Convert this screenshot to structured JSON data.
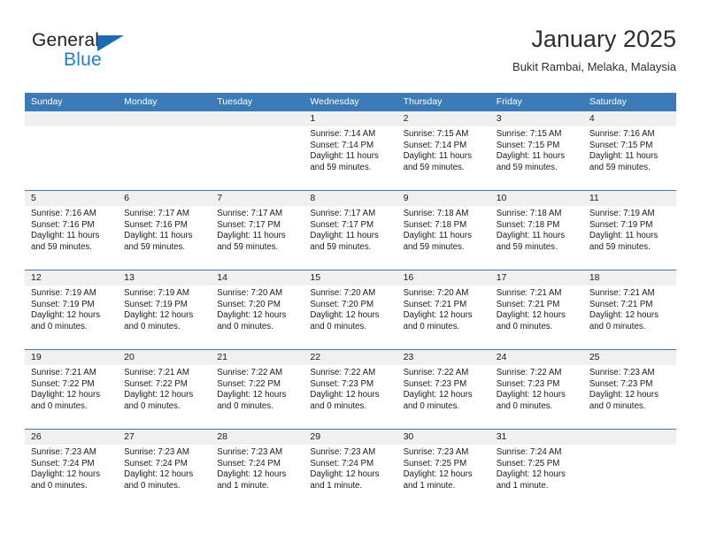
{
  "brand": {
    "name_top": "General",
    "name_bottom": "Blue",
    "accent_color": "#1d80c8",
    "triangle_color": "#1b6cb3"
  },
  "header": {
    "title": "January 2025",
    "subtitle": "Bukit Rambai, Melaka, Malaysia"
  },
  "theme": {
    "header_row_bg": "#3b7cb8",
    "daynum_band_bg": "#f0f0f0",
    "text_color": "#1a1a1a"
  },
  "weekdays": [
    "Sunday",
    "Monday",
    "Tuesday",
    "Wednesday",
    "Thursday",
    "Friday",
    "Saturday"
  ],
  "weeks": [
    {
      "days": [
        {
          "num": "",
          "lines": []
        },
        {
          "num": "",
          "lines": []
        },
        {
          "num": "",
          "lines": []
        },
        {
          "num": "1",
          "lines": [
            "Sunrise: 7:14 AM",
            "Sunset: 7:14 PM",
            "Daylight: 11 hours",
            "and 59 minutes."
          ]
        },
        {
          "num": "2",
          "lines": [
            "Sunrise: 7:15 AM",
            "Sunset: 7:14 PM",
            "Daylight: 11 hours",
            "and 59 minutes."
          ]
        },
        {
          "num": "3",
          "lines": [
            "Sunrise: 7:15 AM",
            "Sunset: 7:15 PM",
            "Daylight: 11 hours",
            "and 59 minutes."
          ]
        },
        {
          "num": "4",
          "lines": [
            "Sunrise: 7:16 AM",
            "Sunset: 7:15 PM",
            "Daylight: 11 hours",
            "and 59 minutes."
          ]
        }
      ]
    },
    {
      "days": [
        {
          "num": "5",
          "lines": [
            "Sunrise: 7:16 AM",
            "Sunset: 7:16 PM",
            "Daylight: 11 hours",
            "and 59 minutes."
          ]
        },
        {
          "num": "6",
          "lines": [
            "Sunrise: 7:17 AM",
            "Sunset: 7:16 PM",
            "Daylight: 11 hours",
            "and 59 minutes."
          ]
        },
        {
          "num": "7",
          "lines": [
            "Sunrise: 7:17 AM",
            "Sunset: 7:17 PM",
            "Daylight: 11 hours",
            "and 59 minutes."
          ]
        },
        {
          "num": "8",
          "lines": [
            "Sunrise: 7:17 AM",
            "Sunset: 7:17 PM",
            "Daylight: 11 hours",
            "and 59 minutes."
          ]
        },
        {
          "num": "9",
          "lines": [
            "Sunrise: 7:18 AM",
            "Sunset: 7:18 PM",
            "Daylight: 11 hours",
            "and 59 minutes."
          ]
        },
        {
          "num": "10",
          "lines": [
            "Sunrise: 7:18 AM",
            "Sunset: 7:18 PM",
            "Daylight: 11 hours",
            "and 59 minutes."
          ]
        },
        {
          "num": "11",
          "lines": [
            "Sunrise: 7:19 AM",
            "Sunset: 7:19 PM",
            "Daylight: 11 hours",
            "and 59 minutes."
          ]
        }
      ]
    },
    {
      "days": [
        {
          "num": "12",
          "lines": [
            "Sunrise: 7:19 AM",
            "Sunset: 7:19 PM",
            "Daylight: 12 hours",
            "and 0 minutes."
          ]
        },
        {
          "num": "13",
          "lines": [
            "Sunrise: 7:19 AM",
            "Sunset: 7:19 PM",
            "Daylight: 12 hours",
            "and 0 minutes."
          ]
        },
        {
          "num": "14",
          "lines": [
            "Sunrise: 7:20 AM",
            "Sunset: 7:20 PM",
            "Daylight: 12 hours",
            "and 0 minutes."
          ]
        },
        {
          "num": "15",
          "lines": [
            "Sunrise: 7:20 AM",
            "Sunset: 7:20 PM",
            "Daylight: 12 hours",
            "and 0 minutes."
          ]
        },
        {
          "num": "16",
          "lines": [
            "Sunrise: 7:20 AM",
            "Sunset: 7:21 PM",
            "Daylight: 12 hours",
            "and 0 minutes."
          ]
        },
        {
          "num": "17",
          "lines": [
            "Sunrise: 7:21 AM",
            "Sunset: 7:21 PM",
            "Daylight: 12 hours",
            "and 0 minutes."
          ]
        },
        {
          "num": "18",
          "lines": [
            "Sunrise: 7:21 AM",
            "Sunset: 7:21 PM",
            "Daylight: 12 hours",
            "and 0 minutes."
          ]
        }
      ]
    },
    {
      "days": [
        {
          "num": "19",
          "lines": [
            "Sunrise: 7:21 AM",
            "Sunset: 7:22 PM",
            "Daylight: 12 hours",
            "and 0 minutes."
          ]
        },
        {
          "num": "20",
          "lines": [
            "Sunrise: 7:21 AM",
            "Sunset: 7:22 PM",
            "Daylight: 12 hours",
            "and 0 minutes."
          ]
        },
        {
          "num": "21",
          "lines": [
            "Sunrise: 7:22 AM",
            "Sunset: 7:22 PM",
            "Daylight: 12 hours",
            "and 0 minutes."
          ]
        },
        {
          "num": "22",
          "lines": [
            "Sunrise: 7:22 AM",
            "Sunset: 7:23 PM",
            "Daylight: 12 hours",
            "and 0 minutes."
          ]
        },
        {
          "num": "23",
          "lines": [
            "Sunrise: 7:22 AM",
            "Sunset: 7:23 PM",
            "Daylight: 12 hours",
            "and 0 minutes."
          ]
        },
        {
          "num": "24",
          "lines": [
            "Sunrise: 7:22 AM",
            "Sunset: 7:23 PM",
            "Daylight: 12 hours",
            "and 0 minutes."
          ]
        },
        {
          "num": "25",
          "lines": [
            "Sunrise: 7:23 AM",
            "Sunset: 7:23 PM",
            "Daylight: 12 hours",
            "and 0 minutes."
          ]
        }
      ]
    },
    {
      "days": [
        {
          "num": "26",
          "lines": [
            "Sunrise: 7:23 AM",
            "Sunset: 7:24 PM",
            "Daylight: 12 hours",
            "and 0 minutes."
          ]
        },
        {
          "num": "27",
          "lines": [
            "Sunrise: 7:23 AM",
            "Sunset: 7:24 PM",
            "Daylight: 12 hours",
            "and 0 minutes."
          ]
        },
        {
          "num": "28",
          "lines": [
            "Sunrise: 7:23 AM",
            "Sunset: 7:24 PM",
            "Daylight: 12 hours",
            "and 1 minute."
          ]
        },
        {
          "num": "29",
          "lines": [
            "Sunrise: 7:23 AM",
            "Sunset: 7:24 PM",
            "Daylight: 12 hours",
            "and 1 minute."
          ]
        },
        {
          "num": "30",
          "lines": [
            "Sunrise: 7:23 AM",
            "Sunset: 7:25 PM",
            "Daylight: 12 hours",
            "and 1 minute."
          ]
        },
        {
          "num": "31",
          "lines": [
            "Sunrise: 7:24 AM",
            "Sunset: 7:25 PM",
            "Daylight: 12 hours",
            "and 1 minute."
          ]
        },
        {
          "num": "",
          "lines": []
        }
      ]
    }
  ]
}
